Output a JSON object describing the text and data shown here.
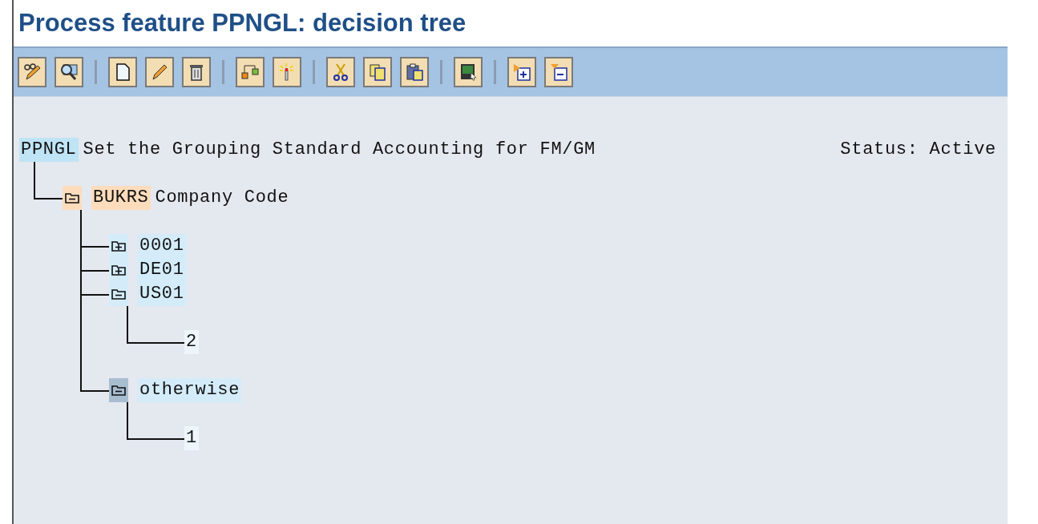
{
  "window": {
    "title": "Process feature PPNGL: decision tree"
  },
  "header": {
    "key": "PPNGL",
    "text": "Set the Grouping Standard Accounting for FM/GM",
    "status": "Status: Active"
  },
  "tree": [
    {
      "kind": "field",
      "key": "BUKRS",
      "text": "Company Code",
      "expanded": true,
      "selected": false,
      "children": [
        {
          "kind": "value",
          "label": "0001",
          "expanded": false,
          "selected": false
        },
        {
          "kind": "value",
          "label": "DE01",
          "expanded": false,
          "selected": false
        },
        {
          "kind": "value",
          "label": "US01",
          "expanded": true,
          "selected": false,
          "children": [
            {
              "kind": "result",
              "label": "2"
            }
          ]
        },
        {
          "kind": "value",
          "label": "otherwise",
          "expanded": true,
          "selected": true,
          "children": [
            {
              "kind": "result",
              "label": "1"
            }
          ]
        }
      ]
    }
  ]
}
